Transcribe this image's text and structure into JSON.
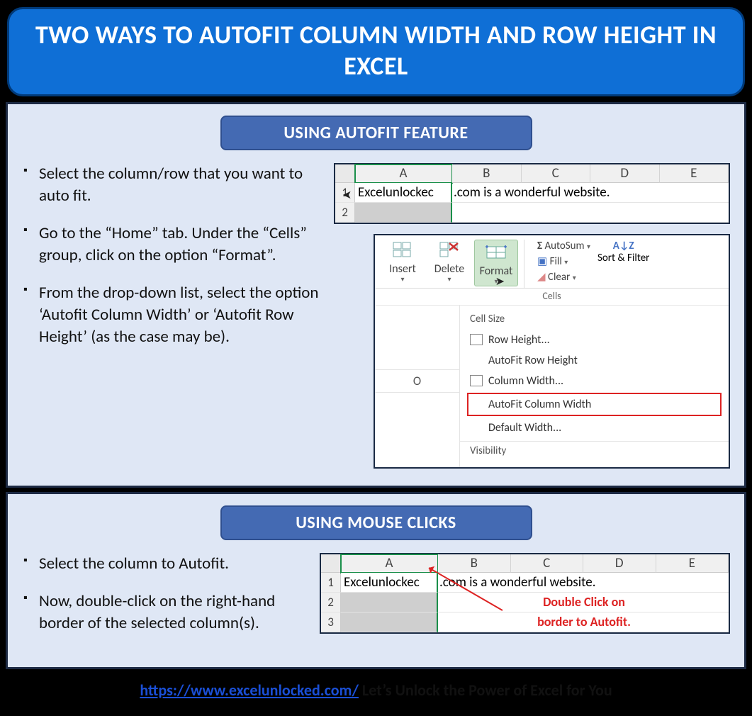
{
  "title": "TWO WAYS TO AUTOFIT COLUMN WIDTH AND ROW HEIGHT IN EXCEL",
  "section1": {
    "heading": "USING AUTOFIT FEATURE",
    "bullets": [
      "Select the column/row that you want to auto fit.",
      "Go to the “Home” tab. Under the “Cells” group, click on the option “Format”.",
      "From the drop-down list, select the option ‘Autofit Column Width’ or ‘Autofit Row Height’ (as the case may be)."
    ],
    "sheet_cols": [
      "A",
      "B",
      "C",
      "D",
      "E"
    ],
    "sheet_rows": [
      "1",
      "2"
    ],
    "cell_text_left": "Excelunlockec",
    "cell_text_right": ".com is a wonderful website.",
    "ribbon": {
      "insert": "Insert",
      "delete": "Delete",
      "format": "Format",
      "cells_group": "Cells",
      "autosum": "AutoSum",
      "fill": "Fill",
      "clear": "Clear",
      "sort": "Sort & Filter",
      "az": "A↓Z"
    },
    "menu": {
      "header1": "Cell Size",
      "row_height": "Row Height...",
      "autofit_row": "AutoFit Row Height",
      "col_width": "Column Width...",
      "autofit_col": "AutoFit Column Width",
      "default_w": "Default Width...",
      "header2": "Visibility"
    },
    "col_O": "O"
  },
  "section2": {
    "heading": "USING MOUSE CLICKS",
    "bullets": [
      "Select the column to Autofit.",
      "Now, double-click on the right-hand border of the selected column(s)."
    ],
    "sheet_cols": [
      "A",
      "B",
      "C",
      "D",
      "E"
    ],
    "sheet_rows": [
      "1",
      "2",
      "3"
    ],
    "cell_text_left": "Excelunlockec",
    "cell_text_right": ".com is a wonderful website.",
    "callout_l1": "Double Click on",
    "callout_l2": "border to Autofit."
  },
  "footer": {
    "url_text": "https://www.excelunlocked.com/",
    "tagline": " Let’s Unlock the Power of Excel for You"
  }
}
